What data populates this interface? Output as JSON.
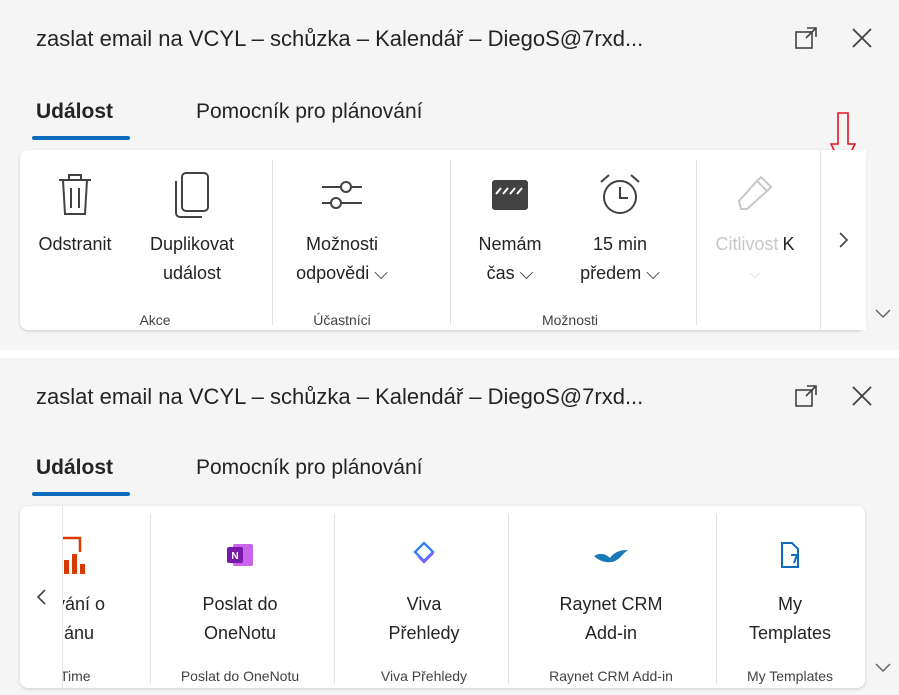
{
  "window": {
    "title": "zaslat email na VCYL – schůzka – Kalendář – DiegoS@7rxd...",
    "tabs": [
      "Událost",
      "Pomocník pro plánování"
    ]
  },
  "ribbon1": {
    "buttons": [
      {
        "label1": "Odstranit",
        "label2": "",
        "icon": "trash-icon"
      },
      {
        "label1": "Duplikovat",
        "label2": "událost",
        "icon": "copy-icon"
      },
      {
        "label1": "Možnosti",
        "label2": "odpovědi ⌵",
        "icon": "sliders-icon"
      },
      {
        "label1": "Nemám",
        "label2": "čas ⌵",
        "icon": "busy-icon"
      },
      {
        "label1": "15 min",
        "label2": "předem ⌵",
        "icon": "alarm-icon"
      },
      {
        "label1": "Citlivost",
        "label2": "⌵",
        "icon": "sensitivity-icon"
      },
      {
        "label1": "K",
        "label2": "",
        "icon": ""
      }
    ],
    "groups": [
      "Akce",
      "Účastníci",
      "Možnosti"
    ]
  },
  "ribbon2": {
    "buttons": [
      {
        "label1": "vání o",
        "label2": "ánu",
        "icon": "analytics-icon"
      },
      {
        "label1": "Poslat do",
        "label2": "OneNotu",
        "icon": "onenote-icon"
      },
      {
        "label1": "Viva",
        "label2": "Přehledy",
        "icon": "viva-icon"
      },
      {
        "label1": "Raynet CRM",
        "label2": "Add-in",
        "icon": "raynet-icon"
      },
      {
        "label1": "My",
        "label2": "Templates",
        "icon": "templates-icon"
      }
    ],
    "groups": [
      "Time",
      "Poslat do OneNotu",
      "Viva Přehledy",
      "Raynet CRM Add-in",
      "My Templates"
    ]
  },
  "colors": {
    "accent": "#0f6cbd",
    "annotation": "#e81123",
    "onenote": "#7719aa",
    "viva": "#3b82f6",
    "raynet": "#1b79b8",
    "analytics": "#d83b01"
  }
}
